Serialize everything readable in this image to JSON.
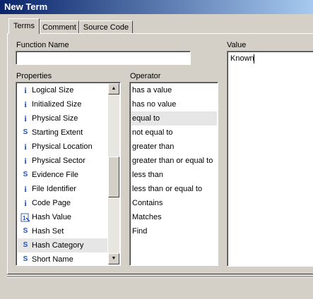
{
  "window": {
    "title": "New Term"
  },
  "tabs": [
    {
      "label": "Terms"
    },
    {
      "label": "Comment"
    },
    {
      "label": "Source Code"
    }
  ],
  "function_name": {
    "label": "Function Name",
    "value": ""
  },
  "properties": {
    "label": "Properties",
    "items": [
      {
        "icon": "i",
        "label": "Logical Size"
      },
      {
        "icon": "i",
        "label": "Initialized Size"
      },
      {
        "icon": "i",
        "label": "Physical Size"
      },
      {
        "icon": "s",
        "label": "Starting Extent"
      },
      {
        "icon": "i",
        "label": "Physical Location"
      },
      {
        "icon": "i",
        "label": "Physical Sector"
      },
      {
        "icon": "s",
        "label": "Evidence File"
      },
      {
        "icon": "i",
        "label": "File Identifier"
      },
      {
        "icon": "i",
        "label": "Code Page"
      },
      {
        "icon": "hash",
        "label": "Hash Value"
      },
      {
        "icon": "s",
        "label": "Hash Set"
      },
      {
        "icon": "s",
        "label": "Hash Category"
      },
      {
        "icon": "s",
        "label": "Short Name"
      }
    ],
    "selected": "Hash Category"
  },
  "operator": {
    "label": "Operator",
    "items": [
      "has a value",
      "has no value",
      "equal to",
      "not equal to",
      "greater than",
      "greater than or equal to",
      "less than",
      "less than or equal to",
      "Contains",
      "Matches",
      "Find"
    ],
    "selected": "equal to"
  },
  "value": {
    "label": "Value",
    "text": "Known"
  }
}
